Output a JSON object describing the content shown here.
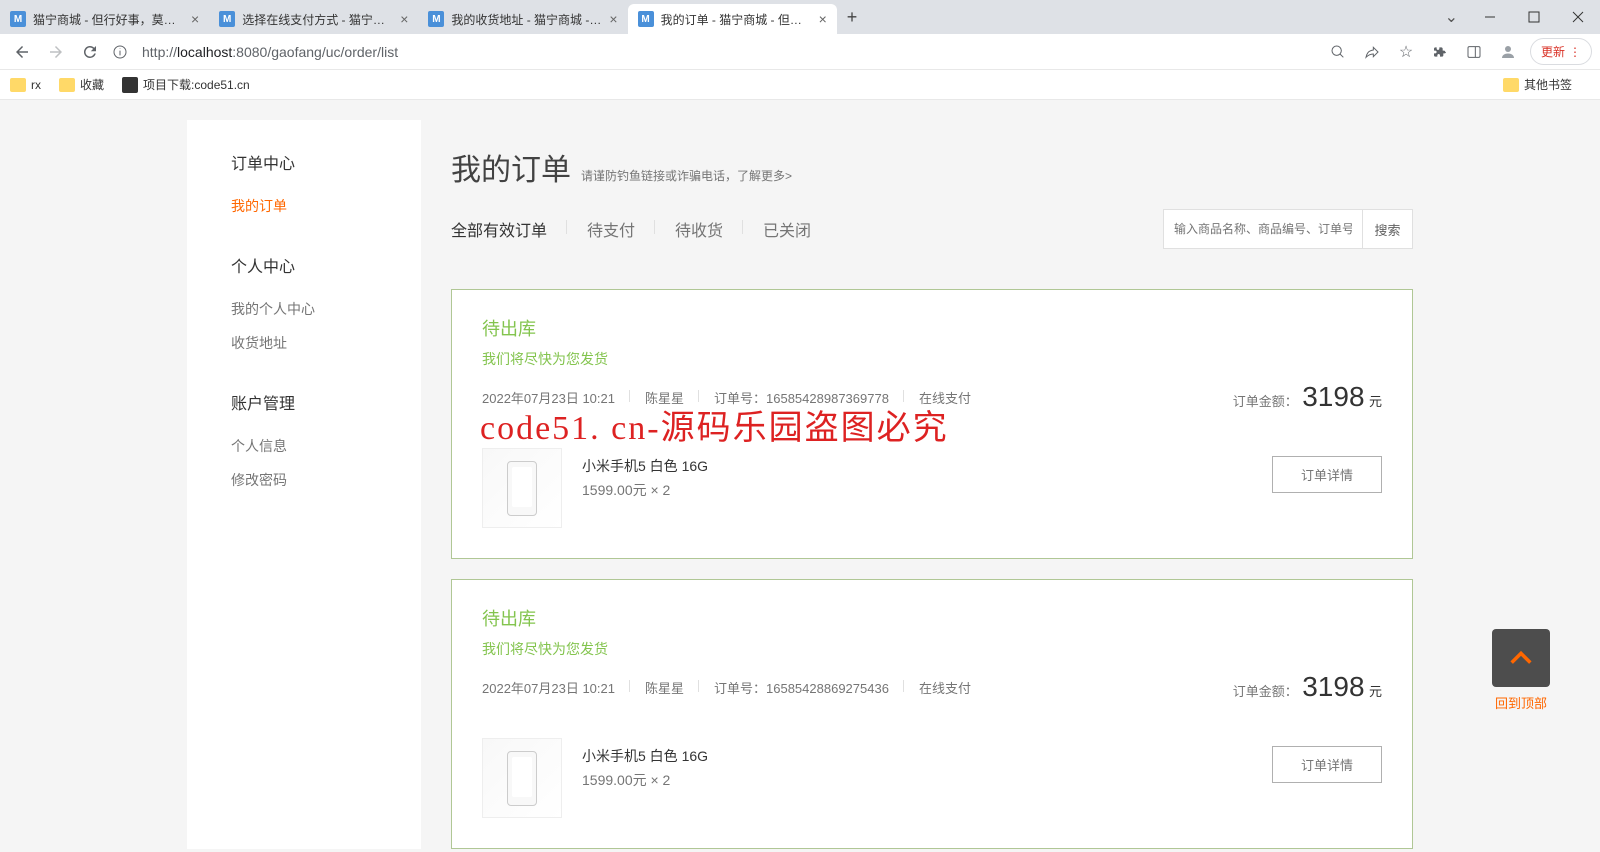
{
  "browser": {
    "tabs": [
      {
        "title": "猫宁商城 - 但行好事，莫问前程"
      },
      {
        "title": "选择在线支付方式 - 猫宁商城 - 但"
      },
      {
        "title": "我的收货地址 - 猫宁商城 - 但行"
      },
      {
        "title": "我的订单 - 猫宁商城 - 但行好事"
      }
    ],
    "url_host": "localhost",
    "url_port": ":8080",
    "url_path": "/gaofang/uc/order/list",
    "url_prefix": "http://",
    "update": "更新",
    "bookmarks": {
      "rx": "rx",
      "fav": "收藏",
      "dl": "项目下载:code51.cn",
      "other": "其他书签"
    }
  },
  "sidebar": {
    "g1": {
      "title": "订单中心",
      "items": [
        "我的订单"
      ]
    },
    "g2": {
      "title": "个人中心",
      "items": [
        "我的个人中心",
        "收货地址"
      ]
    },
    "g3": {
      "title": "账户管理",
      "items": [
        "个人信息",
        "修改密码"
      ]
    }
  },
  "page_head": {
    "title": "我的订单",
    "subtitle": "请谨防钓鱼链接或诈骗电话，了解更多>"
  },
  "filters": [
    "全部有效订单",
    "待支付",
    "待收货",
    "已关闭"
  ],
  "search": {
    "placeholder": "输入商品名称、商品编号、订单号",
    "btn": "搜索"
  },
  "orders": [
    {
      "status": "待出库",
      "msg": "我们将尽快为您发货",
      "date": "2022年07月23日 10:21",
      "customer": "陈星星",
      "order_no_label": "订单号：",
      "order_no": "16585428987369778",
      "pay_method": "在线支付",
      "amount_label": "订单金额：",
      "amount": "3198",
      "amount_unit": " 元",
      "product": "小米手机5 白色 16G",
      "price_qty": "1599.00元 × 2",
      "detail_btn": "订单详情"
    },
    {
      "status": "待出库",
      "msg": "我们将尽快为您发货",
      "date": "2022年07月23日 10:21",
      "customer": "陈星星",
      "order_no_label": "订单号：",
      "order_no": "16585428869275436",
      "pay_method": "在线支付",
      "amount_label": "订单金额：",
      "amount": "3198",
      "amount_unit": " 元",
      "product": "小米手机5 白色 16G",
      "price_qty": "1599.00元 × 2",
      "detail_btn": "订单详情"
    }
  ],
  "back_top": "回到顶部",
  "watermark": "code51. cn-源码乐园盗图必究"
}
